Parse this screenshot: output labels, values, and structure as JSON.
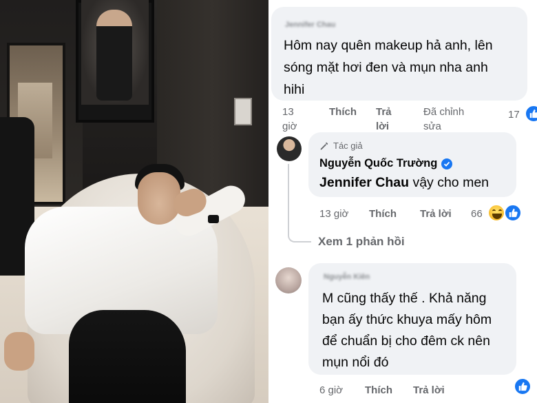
{
  "comments": [
    {
      "author": "Jennifer Chau",
      "text_lines": [
        "Hôm nay quên makeup hả anh, lên",
        "sóng mặt hơi đen và mụn nha anh",
        "hihi"
      ],
      "time": [
        "13",
        "giờ"
      ],
      "like": "Thích",
      "reply": [
        "Trả",
        "lời"
      ],
      "edited": [
        "Đã chỉnh",
        "sửa"
      ],
      "reaction_count": "17",
      "reaction_icon": "like-icon"
    },
    {
      "badge": "Tác giả",
      "author": "Nguyễn Quốc Trường",
      "mention": "Jennifer Chau",
      "text_rest": " vậy cho men",
      "time": "13 giờ",
      "like": "Thích",
      "reply": "Trả lời",
      "reaction_count": "66",
      "reaction_icons": [
        "haha-icon",
        "like-icon"
      ],
      "view_replies": "Xem 1 phản hồi"
    },
    {
      "author": "Nguyễn Kiên",
      "text_lines": [
        "M cũng thấy thế . Khả năng",
        "bạn ấy thức khuya mấy hôm",
        "để chuẩn bị cho đêm ck nên",
        "mụn nổi đó"
      ],
      "time": "6 giờ",
      "like": "Thích",
      "reply": "Trả lời",
      "reaction_icon": "like-icon"
    }
  ],
  "colors": {
    "bubble": "#f0f2f5",
    "meta_text": "#65676b",
    "like_blue": "#1877f2",
    "verified_blue": "#1877f2"
  }
}
